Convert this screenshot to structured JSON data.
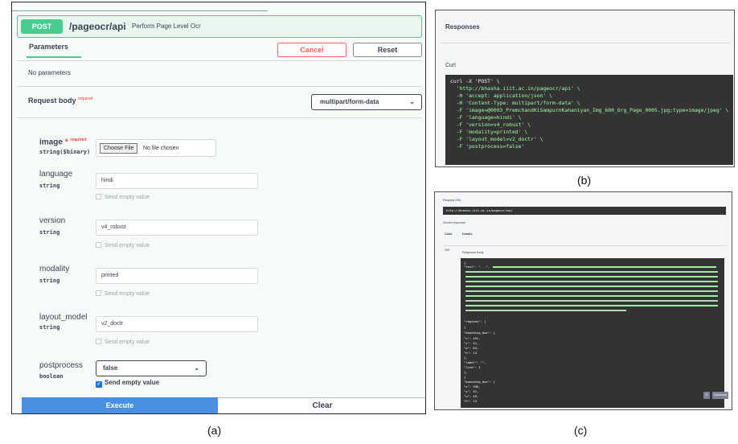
{
  "panel_a": {
    "method": "POST",
    "path": "/pageocr/api",
    "summary": "Perform Page Level Ocr",
    "tab_parameters": "Parameters",
    "cancel": "Cancel",
    "reset": "Reset",
    "no_parameters": "No parameters",
    "request_body": "Request body",
    "required": "required",
    "content_type": "multipart/form-data",
    "fields": {
      "image": {
        "name": "image",
        "req_star": "*",
        "req": "required",
        "type": "string($binary)",
        "choose": "Choose File",
        "no_file": "No file chosen"
      },
      "language": {
        "name": "language",
        "type": "string",
        "value": "hindi",
        "send_empty": "Send empty value"
      },
      "version": {
        "name": "version",
        "type": "string",
        "value": "v4_robust",
        "send_empty": "Send empty value"
      },
      "modality": {
        "name": "modality",
        "type": "string",
        "value": "printed",
        "send_empty": "Send empty value"
      },
      "layout_model": {
        "name": "layout_model",
        "type": "string",
        "value": "v2_doctr",
        "send_empty": "Send empty value"
      },
      "postprocess": {
        "name": "postprocess",
        "type": "boolean",
        "value": "false",
        "send_empty": "Send empty value",
        "checked": true
      }
    },
    "execute": "Execute",
    "clear": "Clear",
    "label": "(a)"
  },
  "panel_b": {
    "title": "Responses",
    "curl_label": "Curl",
    "curl_lines": [
      "curl -X 'POST' \\",
      "  'http://bhasha.iiit.ac.in/pageocr/api' \\",
      "  -H 'accept: application/json' \\",
      "  -H 'Content-Type: multipart/form-data' \\",
      "  -F 'image=@0093_PremchandKiSampurnKahaniyan_Img_600_Org_Page_0005.jpg;type=image/jpeg' \\",
      "  -F 'language=hindi' \\",
      "  -F 'version=v4_robust' \\",
      "  -F 'modality=printed' \\",
      "  -F 'layout_model=v2_doctr' \\",
      "  -F 'postprocess=false'"
    ],
    "label": "(b)"
  },
  "panel_c": {
    "request_url_label": "Request URL",
    "request_url": "http://bhasha.iiit.ac.in/pageocr/api",
    "server_response": "Server response",
    "code_header": "Code",
    "details_header": "Details",
    "code": "200",
    "response_body_label": "Response body",
    "json_lines": [
      "{",
      "  \"text\": \"...\",",
      "  \"regions\": [",
      "    {",
      "      \"bounding_box\": {",
      "        \"x\": 491,",
      "        \"y\": 51,",
      "        \"w\": 84,",
      "        \"h\": 14",
      "      },",
      "      \"label\": \"\",",
      "      \"line\": 1",
      "    },",
      "    {",
      "      \"bounding_box\": {",
      "        \"x\": 556,",
      "        \"y\": 51,",
      "        \"w\": 49,",
      "        \"h\": 13"
    ],
    "copy_btn": "⎘",
    "download_btn": "Download",
    "label": "(c)"
  }
}
